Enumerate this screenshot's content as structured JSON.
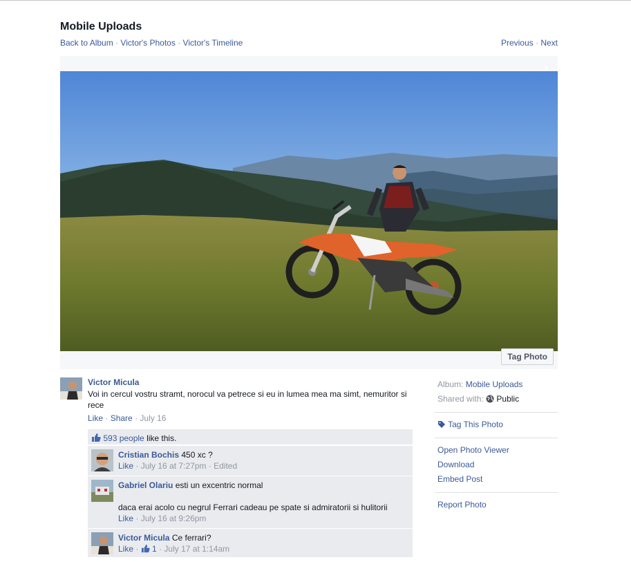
{
  "header": {
    "title": "Mobile Uploads",
    "back_to_album": "Back to Album",
    "photos_link": "Victor's Photos",
    "timeline_link": "Victor's Timeline",
    "previous": "Previous",
    "next": "Next",
    "dot": "·"
  },
  "photo": {
    "tag_button": "Tag Photo"
  },
  "post": {
    "author": "Victor Micula",
    "text": "Voi in cercul vostru stramt, norocul va petrece si eu in lumea mea ma simt, nemuritor si rece",
    "like": "Like",
    "share": "Share",
    "date": "July 16"
  },
  "likes": {
    "count": "593 people",
    "suffix": "like this."
  },
  "comments": [
    {
      "author": "Cristian Bochis",
      "text": "450 xc ?",
      "like": "Like",
      "time": "July 16 at 7:27pm",
      "edited": "Edited"
    },
    {
      "author": "Gabriel Olariu",
      "text": "esti un excentric normal",
      "text2": "daca erai acolo cu negrul Ferrari cadeau pe spate si admiratorii si hulitorii",
      "like": "Like",
      "time": "July 16 at 9:26pm"
    },
    {
      "author": "Victor Micula",
      "text": "Ce ferrari?",
      "like": "Like",
      "like_count": "1",
      "time": "July 17 at 1:14am"
    }
  ],
  "sidebar": {
    "album_label": "Album:",
    "album_name": "Mobile Uploads",
    "shared_label": "Shared with:",
    "shared_value": "Public",
    "tag_this_photo": "Tag This Photo",
    "open_viewer": "Open Photo Viewer",
    "download": "Download",
    "embed": "Embed Post",
    "report": "Report Photo"
  },
  "icons": {
    "expand": "expand-icon",
    "globe": "globe-icon",
    "tag": "tag-icon",
    "thumbs_up": "thumbs-up-icon"
  },
  "colors": {
    "link": "#3b5998",
    "muted": "#9197a3",
    "comment_bg": "#e9ebee"
  }
}
